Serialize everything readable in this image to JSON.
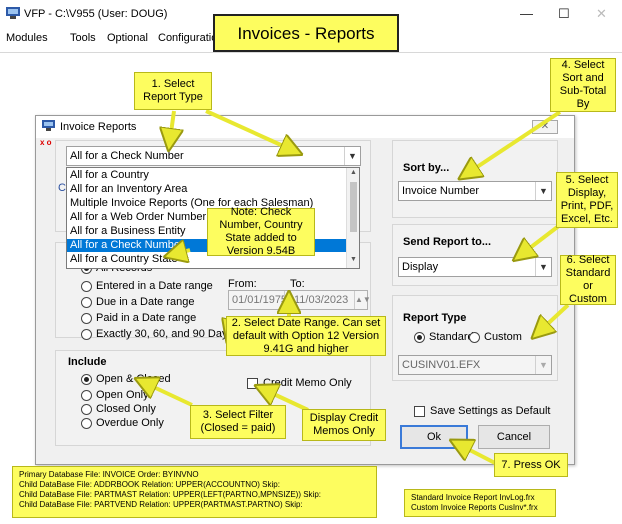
{
  "window": {
    "title": "VFP - C:\\V955 (User: DOUG)",
    "minimize": "—",
    "maximize": "☐",
    "close": "✕"
  },
  "menu": [
    "Modules",
    "Tools",
    "Optional",
    "Configuratio"
  ],
  "banner": "Invoices - Reports",
  "dialog": {
    "title": "Invoice Reports",
    "close": "✕",
    "xo": "x o",
    "report_type_value": "All for a Check Number",
    "left_partial_text": "Cl",
    "dropdown_items": [
      "All for a Country",
      "All for an Inventory Area",
      "Multiple Invoice Reports  (One for each Salesman)",
      "All for a Web Order Number",
      "All for a Business Entity",
      "All for a Check Number",
      "All for a Country State"
    ],
    "dropdown_selected_index": 5,
    "date_range": {
      "options": [
        "All Records",
        "Entered in a Date range",
        "Due in a Date range",
        "Paid in a Date range",
        "Exactly 30, 60, and 90 Days"
      ],
      "selected_index": 0,
      "from_label": "From:",
      "to_label": "To:",
      "from_value": "01/01/1975",
      "to_value": "11/03/2023"
    },
    "include": {
      "label": "Include",
      "options": [
        "Open & Closed",
        "Open Only",
        "Closed Only",
        "Overdue Only"
      ],
      "selected_index": 0,
      "credit_memo_label": "Credit Memo Only"
    },
    "sort_by": {
      "label": "Sort by...",
      "value": "Invoice Number"
    },
    "send_to": {
      "label": "Send Report to...",
      "value": "Display"
    },
    "report_type": {
      "label": "Report Type",
      "options": [
        "Standard",
        "Custom"
      ],
      "selected_index": 0,
      "file": "CUSINV01.EFX"
    },
    "save_settings_label": "Save Settings as Default",
    "ok_label": "Ok",
    "cancel_label": "Cancel"
  },
  "callouts": {
    "c1": "1. Select Report Type",
    "c2": "2. Select Date Range.  Can set default with Option 12 Version 9.41G and higher",
    "c3": "3. Select Filter (Closed = paid)",
    "c4": "4. Select Sort and Sub-Total By",
    "c5": "5. Select Display, Print, PDF, Excel, Etc.",
    "c6": "6. Select Standard or Custom",
    "c7": "7. Press OK",
    "note": "Note: Check Number, Country State added to Version 9.54B",
    "credit": "Display Credit Memos Only",
    "db_lines": [
      "Primary Database File: INVOICE Order: BYINVNO",
      "   Child DataBase File: ADDRBOOK Relation: UPPER(ACCOUNTNO) Skip:",
      "   Child DataBase File: PARTMAST Relation: UPPER(LEFT(PARTNO,MPNSIZE)) Skip:",
      "      Child DataBase File: PARTVEND Relation: UPPER(PARTMAST.PARTNO) Skip:"
    ],
    "report_files": [
      "Standard Invoice Report InvLog.frx",
      "Custom Invoice Reports  CusInv*.frx"
    ]
  },
  "colors": {
    "callout_bg": "#fdfd5f",
    "arrow": "#e8e830",
    "selection": "#0078d7"
  }
}
